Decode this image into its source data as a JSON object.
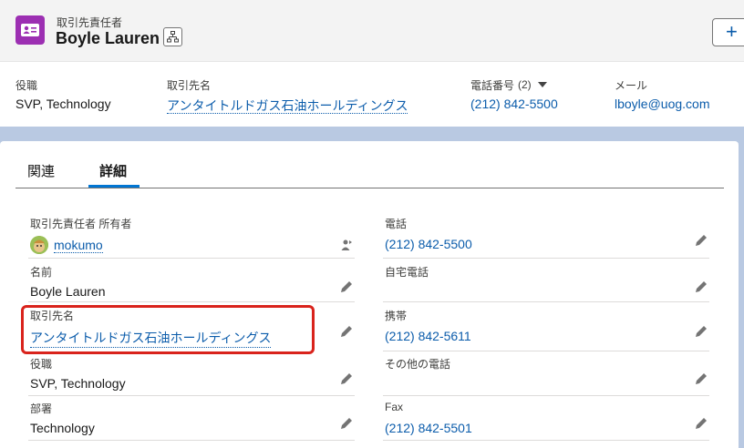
{
  "header": {
    "object_type": "取引先責任者",
    "record_name": "Boyle Lauren",
    "new_button": "+"
  },
  "highlights": {
    "title": {
      "label": "役職",
      "value": "SVP, Technology"
    },
    "account": {
      "label": "取引先名",
      "value": "アンタイトルドガス石油ホールディングス"
    },
    "phone": {
      "label": "電話番号",
      "count": "(2)",
      "value": "(212) 842-5500"
    },
    "email": {
      "label": "メール",
      "value": "lboyle@uog.com"
    }
  },
  "tabs": {
    "related": "関連",
    "details": "詳細"
  },
  "fields": {
    "owner": {
      "label": "取引先責任者 所有者",
      "value": "mokumo"
    },
    "name": {
      "label": "名前",
      "value": "Boyle Lauren"
    },
    "account": {
      "label": "取引先名",
      "value": "アンタイトルドガス石油ホールディングス"
    },
    "title": {
      "label": "役職",
      "value": "SVP, Technology"
    },
    "department": {
      "label": "部署",
      "value": "Technology"
    },
    "phone": {
      "label": "電話",
      "value": "(212) 842-5500"
    },
    "home_phone": {
      "label": "自宅電話",
      "value": ""
    },
    "mobile": {
      "label": "携帯",
      "value": "(212) 842-5611"
    },
    "other_phone": {
      "label": "その他の電話",
      "value": ""
    },
    "fax": {
      "label": "Fax",
      "value": "(212) 842-5501"
    }
  },
  "colors": {
    "accent": "#0176d3",
    "link": "#0b5cab",
    "object_icon": "#9c2fb2",
    "highlight_box": "#d9231c"
  }
}
